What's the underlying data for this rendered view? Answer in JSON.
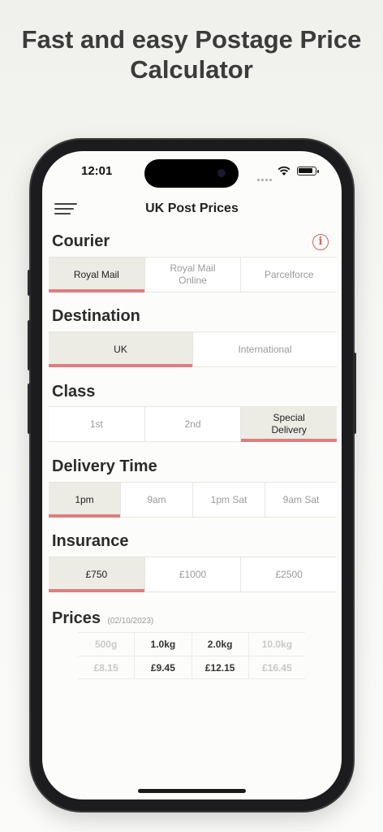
{
  "headline": {
    "line1": "Fast and easy Postage Price",
    "line2": "Calculator"
  },
  "status": {
    "time": "12:01"
  },
  "nav": {
    "title": "UK Post Prices"
  },
  "courier": {
    "title": "Courier",
    "info_glyph": "i",
    "options": [
      {
        "label": "Royal Mail",
        "active": true
      },
      {
        "label": "Royal Mail\nOnline",
        "active": false
      },
      {
        "label": "Parcelforce",
        "active": false
      }
    ]
  },
  "destination": {
    "title": "Destination",
    "options": [
      {
        "label": "UK",
        "active": true
      },
      {
        "label": "International",
        "active": false
      }
    ]
  },
  "class": {
    "title": "Class",
    "options": [
      {
        "label": "1st",
        "active": false
      },
      {
        "label": "2nd",
        "active": false
      },
      {
        "label": "Special\nDelivery",
        "active": true
      }
    ]
  },
  "delivery_time": {
    "title": "Delivery Time",
    "options": [
      {
        "label": "1pm",
        "active": true
      },
      {
        "label": "9am",
        "active": false
      },
      {
        "label": "1pm Sat",
        "active": false
      },
      {
        "label": "9am Sat",
        "active": false
      }
    ]
  },
  "insurance": {
    "title": "Insurance",
    "options": [
      {
        "label": "£750",
        "active": true
      },
      {
        "label": "£1000",
        "active": false
      },
      {
        "label": "£2500",
        "active": false
      }
    ]
  },
  "prices": {
    "title": "Prices",
    "date": "(02/10/2023)",
    "weights": [
      "500g",
      "1.0kg",
      "2.0kg",
      "10.0kg"
    ],
    "amounts": [
      "£8.15",
      "£9.45",
      "£12.15",
      "£16.45"
    ]
  },
  "colors": {
    "accent": "#dc7e80",
    "active_bg": "#ecebe4"
  }
}
